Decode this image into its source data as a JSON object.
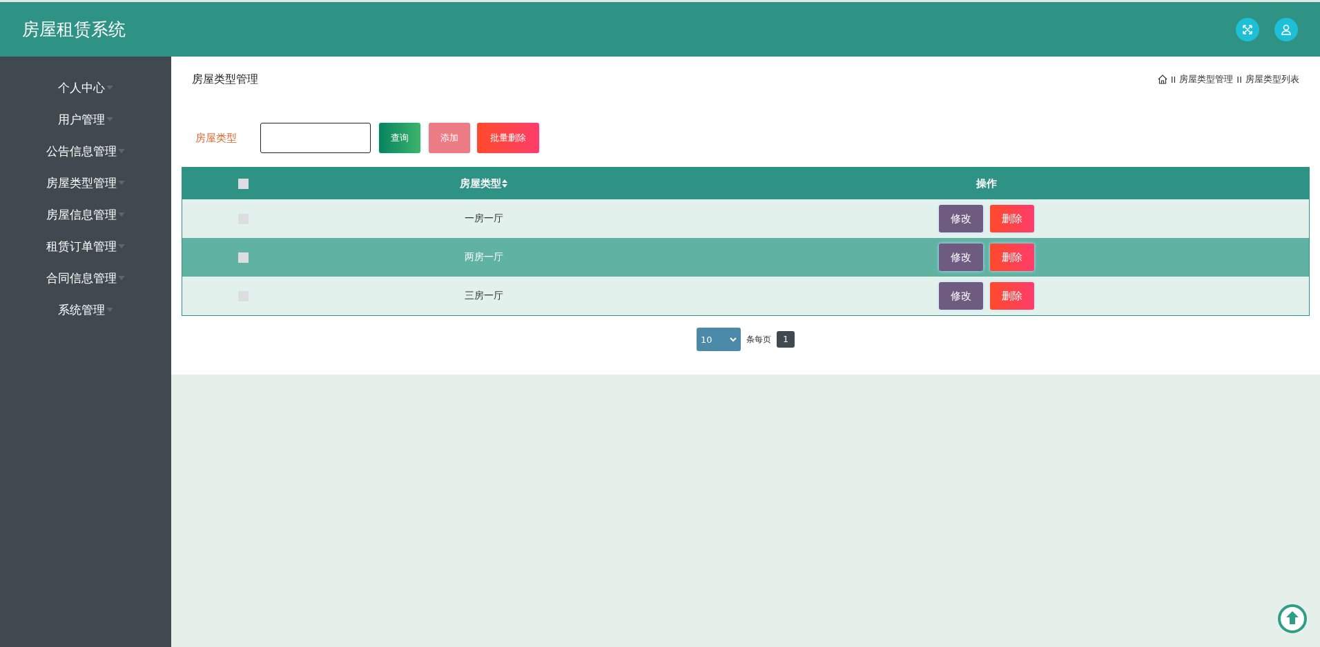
{
  "header": {
    "title": "房屋租赁系统"
  },
  "sidebar": {
    "items": [
      {
        "label": "个人中心",
        "expanded": false
      },
      {
        "label": "用户管理",
        "expanded": false
      },
      {
        "label": "公告信息管理",
        "expanded": false
      },
      {
        "label": "房屋类型管理",
        "expanded": false
      },
      {
        "label": "房屋信息管理",
        "expanded": false
      },
      {
        "label": "租赁订单管理",
        "expanded": false
      },
      {
        "label": "合同信息管理",
        "expanded": false
      },
      {
        "label": "系统管理",
        "expanded": false
      }
    ]
  },
  "page_title": "房屋类型管理",
  "breadcrumb": [
    "II",
    "房屋类型管理",
    "II",
    "房屋类型列表"
  ],
  "search": {
    "label": "房屋类型",
    "buttons": [
      {
        "label": "查询",
        "kind": "query"
      },
      {
        "label": "添加",
        "kind": "add"
      },
      {
        "label": "批量删除",
        "kind": "delete"
      }
    ]
  },
  "table": {
    "select_all": {
      "checked": false
    },
    "columns": [
      "房屋类型",
      "操作"
    ],
    "rows": [
      {
        "checked": false,
        "hovered": false,
        "type": "一房一厅",
        "actions": [
          "修改",
          "删除"
        ]
      },
      {
        "checked": false,
        "hovered": true,
        "type": "两房一厅",
        "actions": [
          "修改",
          "删除"
        ]
      },
      {
        "checked": false,
        "hovered": false,
        "type": "三房一厅",
        "actions": [
          "修改",
          "删除"
        ]
      }
    ]
  },
  "pagination": {
    "page_size": "10",
    "page_size_label": "条每页",
    "pages": [
      {
        "label": "1",
        "selected": true
      }
    ]
  }
}
